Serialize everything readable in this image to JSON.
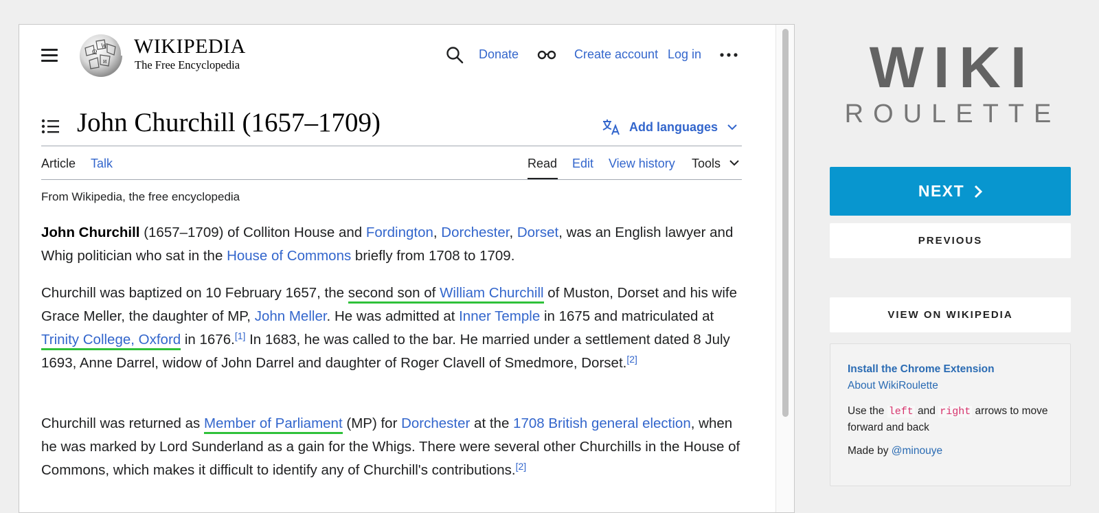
{
  "wiki": {
    "wordmark": "WIKIPEDIA",
    "tagline": "The Free Encyclopedia",
    "header": {
      "donate": "Donate",
      "create_account": "Create account",
      "log_in": "Log in"
    },
    "page_title": "John Churchill (1657–1709)",
    "add_languages": "Add languages",
    "tabs": {
      "article": "Article",
      "talk": "Talk",
      "read": "Read",
      "edit": "Edit",
      "view_history": "View history",
      "tools": "Tools"
    },
    "from_line": "From Wikipedia, the free encyclopedia",
    "p1": {
      "bold": "John Churchill",
      "t1": " (1657–1709) of Colliton House and ",
      "l1": "Fordington",
      "t2": ", ",
      "l2": "Dorchester",
      "t3": ", ",
      "l3": "Dorset",
      "t4": ", was an English lawyer and Whig politician who sat in the ",
      "l4": "House of Commons",
      "t5": " briefly from 1708 to 1709."
    },
    "p2": {
      "t1": "Churchill was baptized on 10 February 1657, the ",
      "hl_text": "second son of ",
      "l1": "William Churchill",
      "t2": " of Muston, Dorset and his wife Grace Meller, the daughter of MP, ",
      "l2": "John Meller",
      "t3": ". He was admitted at ",
      "l3": "Inner Temple",
      "t4": " in 1675 and matriculated at ",
      "l4": "Trinity College, Oxford",
      "t5": " in 1676.",
      "ref1": "[1]",
      "t6": " In 1683, he was called to the bar. He married under a settlement dated 8 July 1693, Anne Darrel, widow of John Darrel and daughter of Roger Clavell of Smedmore, Dorset.",
      "ref2": "[2]"
    },
    "p3": {
      "t1": "Churchill was returned as ",
      "l1": "Member of Parliament",
      "t2": " (MP) for ",
      "l2": "Dorchester",
      "t3": " at the ",
      "l3": "1708 British general election",
      "t4": ", when he was marked by Lord Sunderland as a gain for the Whigs. There were several other Churchills in the House of Commons, which makes it difficult to identify any of Churchill's contributions.",
      "ref": "[2]"
    }
  },
  "roulette": {
    "brand_top": "WIKI",
    "brand_bottom": "ROULETTE",
    "next": "NEXT",
    "previous": "PREVIOUS",
    "view_on_wikipedia": "VIEW ON WIKIPEDIA",
    "install_extension": "Install the Chrome Extension",
    "about": "About WikiRoulette",
    "use_pre": "Use the ",
    "key_left": "left",
    "use_and": " and ",
    "key_right": "right",
    "use_post": " arrows to move forward and back",
    "made_by": "Made by ",
    "author": "@minouye"
  },
  "colors": {
    "link": "#3366cc",
    "next_button": "#0896cf",
    "highlight": "#2fc13a"
  }
}
